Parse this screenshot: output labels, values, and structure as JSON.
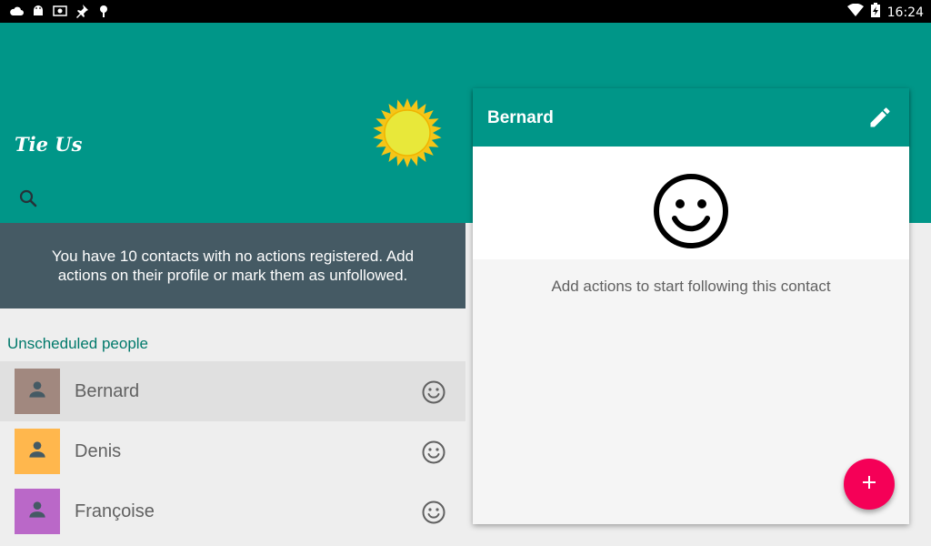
{
  "status_bar": {
    "time": "16:24",
    "left_icons": [
      "cloud-icon",
      "android-icon",
      "photo-icon",
      "pin-icon",
      "debug-icon"
    ],
    "right_icons": [
      "wifi-icon",
      "battery-charging-icon"
    ]
  },
  "app": {
    "title": "Tie Us",
    "search_icon": "search-icon",
    "weather_icon": "sun-icon",
    "colors": {
      "primary": "#009688",
      "accent": "#f50057",
      "banner": "#455a64"
    }
  },
  "banner": {
    "text": "You have 10 contacts with no actions registered. Add actions on their profile or mark them as unfollowed."
  },
  "list": {
    "section_title": "Unscheduled people",
    "items": [
      {
        "name": "Bernard",
        "avatar_color": "#a1887f",
        "selected": true,
        "status_icon": "smiley-icon"
      },
      {
        "name": "Denis",
        "avatar_color": "#ffb74d",
        "selected": false,
        "status_icon": "smiley-icon"
      },
      {
        "name": "Françoise",
        "avatar_color": "#ba68c8",
        "selected": false,
        "status_icon": "smiley-icon"
      }
    ]
  },
  "detail": {
    "title": "Bernard",
    "edit_icon": "pencil-icon",
    "face_icon": "smiley-icon",
    "hint": "Add actions to start following this contact",
    "fab_icon": "plus-icon"
  }
}
